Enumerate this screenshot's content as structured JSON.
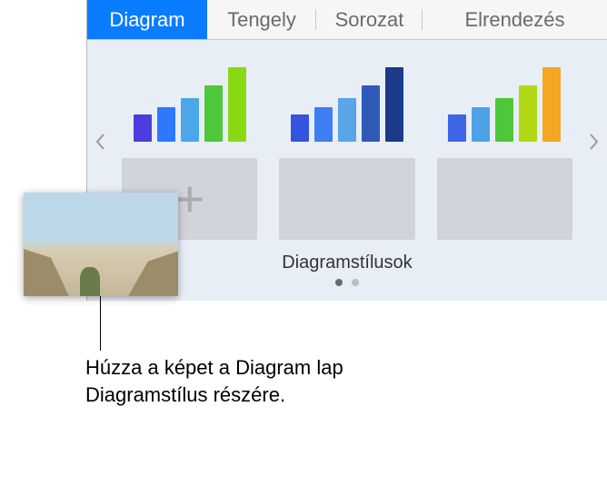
{
  "tabs": {
    "diagram": "Diagram",
    "tengely": "Tengely",
    "sorozat": "Sorozat",
    "elrendezes": "Elrendezés"
  },
  "styles": {
    "label": "Diagramstílusok",
    "add_icon": "+"
  },
  "chart_previews": [
    {
      "colors": [
        "#4a3ee0",
        "#2e78ff",
        "#4aa8e8",
        "#4fc73a",
        "#88d914"
      ],
      "heights": [
        30,
        38,
        48,
        62,
        82
      ]
    },
    {
      "colors": [
        "#3454e0",
        "#3d7ef2",
        "#5aa4e8",
        "#2f5ab8",
        "#1b3b8a"
      ],
      "heights": [
        30,
        38,
        48,
        62,
        82
      ]
    },
    {
      "colors": [
        "#3e66e8",
        "#4da2e6",
        "#4fc73a",
        "#b0d914",
        "#f5a623"
      ],
      "heights": [
        30,
        38,
        48,
        62,
        82
      ]
    }
  ],
  "callout": {
    "text": "Húzza a képet a Diagram lap Diagramstílus részére."
  }
}
